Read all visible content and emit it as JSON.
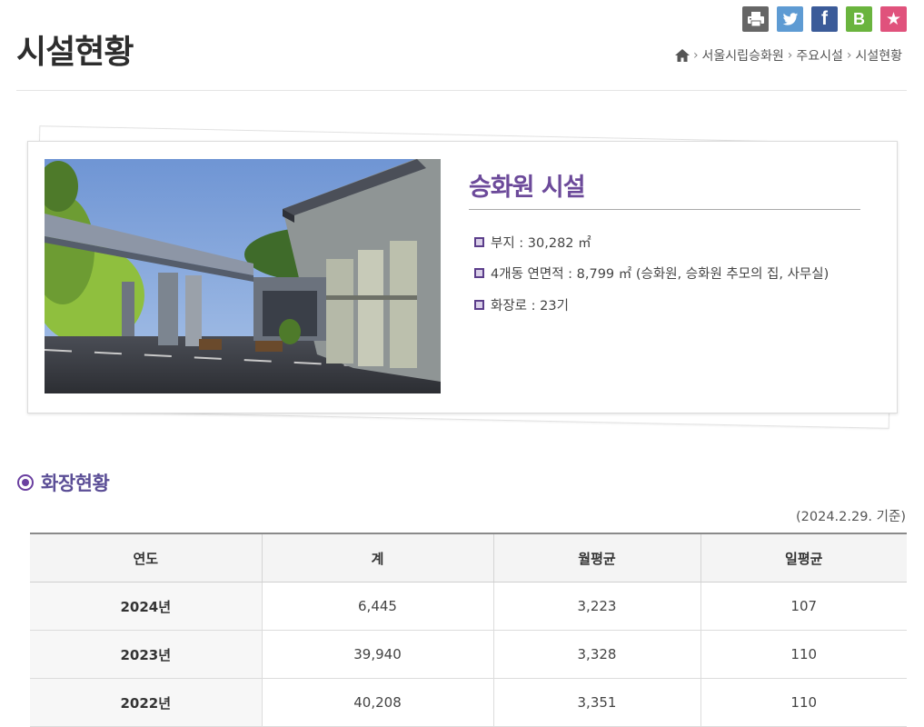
{
  "share": {
    "buttons": [
      {
        "name": "print-button",
        "label": "",
        "color": "#666666"
      },
      {
        "name": "twitter-button",
        "label": "",
        "color": "#5e9bd3"
      },
      {
        "name": "facebook-button",
        "label": "f",
        "color": "#3b5b99"
      },
      {
        "name": "blog-button",
        "label": "B",
        "color": "#6ab43e"
      },
      {
        "name": "favorite-button",
        "label": "★",
        "color": "#e0527c"
      }
    ]
  },
  "header": {
    "title": "시설현황",
    "breadcrumb": [
      "서울시립승화원",
      "주요시설",
      "시설현황"
    ]
  },
  "facility": {
    "title": "승화원 시설",
    "items": [
      "부지 : 30,282 ㎡",
      "4개동 연면적 : 8,799 ㎡ (승화원, 승화원 추모의 집, 사무실)",
      "화장로 : 23기"
    ]
  },
  "cremation": {
    "section_title": "화장현황",
    "base_date": "(2024.2.29. 기준)",
    "columns": [
      "연도",
      "계",
      "월평균",
      "일평균"
    ],
    "rows": [
      [
        "2024년",
        "6,445",
        "3,223",
        "107"
      ],
      [
        "2023년",
        "39,940",
        "3,328",
        "110"
      ],
      [
        "2022년",
        "40,208",
        "3,351",
        "110"
      ]
    ]
  },
  "colors": {
    "accent": "#6a3fa0",
    "title_purple": "#6c4a9a"
  }
}
